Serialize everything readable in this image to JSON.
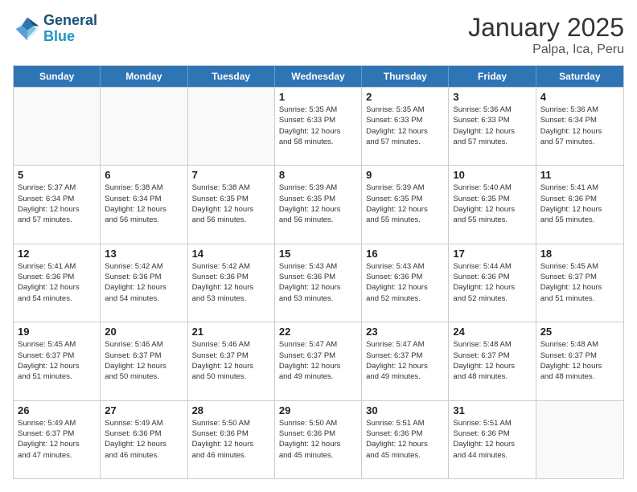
{
  "logo": {
    "line1": "General",
    "line2": "Blue"
  },
  "title": "January 2025",
  "subtitle": "Palpa, Ica, Peru",
  "weekdays": [
    "Sunday",
    "Monday",
    "Tuesday",
    "Wednesday",
    "Thursday",
    "Friday",
    "Saturday"
  ],
  "rows": [
    [
      {
        "day": "",
        "info": ""
      },
      {
        "day": "",
        "info": ""
      },
      {
        "day": "",
        "info": ""
      },
      {
        "day": "1",
        "info": "Sunrise: 5:35 AM\nSunset: 6:33 PM\nDaylight: 12 hours\nand 58 minutes."
      },
      {
        "day": "2",
        "info": "Sunrise: 5:35 AM\nSunset: 6:33 PM\nDaylight: 12 hours\nand 57 minutes."
      },
      {
        "day": "3",
        "info": "Sunrise: 5:36 AM\nSunset: 6:33 PM\nDaylight: 12 hours\nand 57 minutes."
      },
      {
        "day": "4",
        "info": "Sunrise: 5:36 AM\nSunset: 6:34 PM\nDaylight: 12 hours\nand 57 minutes."
      }
    ],
    [
      {
        "day": "5",
        "info": "Sunrise: 5:37 AM\nSunset: 6:34 PM\nDaylight: 12 hours\nand 57 minutes."
      },
      {
        "day": "6",
        "info": "Sunrise: 5:38 AM\nSunset: 6:34 PM\nDaylight: 12 hours\nand 56 minutes."
      },
      {
        "day": "7",
        "info": "Sunrise: 5:38 AM\nSunset: 6:35 PM\nDaylight: 12 hours\nand 56 minutes."
      },
      {
        "day": "8",
        "info": "Sunrise: 5:39 AM\nSunset: 6:35 PM\nDaylight: 12 hours\nand 56 minutes."
      },
      {
        "day": "9",
        "info": "Sunrise: 5:39 AM\nSunset: 6:35 PM\nDaylight: 12 hours\nand 55 minutes."
      },
      {
        "day": "10",
        "info": "Sunrise: 5:40 AM\nSunset: 6:35 PM\nDaylight: 12 hours\nand 55 minutes."
      },
      {
        "day": "11",
        "info": "Sunrise: 5:41 AM\nSunset: 6:36 PM\nDaylight: 12 hours\nand 55 minutes."
      }
    ],
    [
      {
        "day": "12",
        "info": "Sunrise: 5:41 AM\nSunset: 6:36 PM\nDaylight: 12 hours\nand 54 minutes."
      },
      {
        "day": "13",
        "info": "Sunrise: 5:42 AM\nSunset: 6:36 PM\nDaylight: 12 hours\nand 54 minutes."
      },
      {
        "day": "14",
        "info": "Sunrise: 5:42 AM\nSunset: 6:36 PM\nDaylight: 12 hours\nand 53 minutes."
      },
      {
        "day": "15",
        "info": "Sunrise: 5:43 AM\nSunset: 6:36 PM\nDaylight: 12 hours\nand 53 minutes."
      },
      {
        "day": "16",
        "info": "Sunrise: 5:43 AM\nSunset: 6:36 PM\nDaylight: 12 hours\nand 52 minutes."
      },
      {
        "day": "17",
        "info": "Sunrise: 5:44 AM\nSunset: 6:36 PM\nDaylight: 12 hours\nand 52 minutes."
      },
      {
        "day": "18",
        "info": "Sunrise: 5:45 AM\nSunset: 6:37 PM\nDaylight: 12 hours\nand 51 minutes."
      }
    ],
    [
      {
        "day": "19",
        "info": "Sunrise: 5:45 AM\nSunset: 6:37 PM\nDaylight: 12 hours\nand 51 minutes."
      },
      {
        "day": "20",
        "info": "Sunrise: 5:46 AM\nSunset: 6:37 PM\nDaylight: 12 hours\nand 50 minutes."
      },
      {
        "day": "21",
        "info": "Sunrise: 5:46 AM\nSunset: 6:37 PM\nDaylight: 12 hours\nand 50 minutes."
      },
      {
        "day": "22",
        "info": "Sunrise: 5:47 AM\nSunset: 6:37 PM\nDaylight: 12 hours\nand 49 minutes."
      },
      {
        "day": "23",
        "info": "Sunrise: 5:47 AM\nSunset: 6:37 PM\nDaylight: 12 hours\nand 49 minutes."
      },
      {
        "day": "24",
        "info": "Sunrise: 5:48 AM\nSunset: 6:37 PM\nDaylight: 12 hours\nand 48 minutes."
      },
      {
        "day": "25",
        "info": "Sunrise: 5:48 AM\nSunset: 6:37 PM\nDaylight: 12 hours\nand 48 minutes."
      }
    ],
    [
      {
        "day": "26",
        "info": "Sunrise: 5:49 AM\nSunset: 6:37 PM\nDaylight: 12 hours\nand 47 minutes."
      },
      {
        "day": "27",
        "info": "Sunrise: 5:49 AM\nSunset: 6:36 PM\nDaylight: 12 hours\nand 46 minutes."
      },
      {
        "day": "28",
        "info": "Sunrise: 5:50 AM\nSunset: 6:36 PM\nDaylight: 12 hours\nand 46 minutes."
      },
      {
        "day": "29",
        "info": "Sunrise: 5:50 AM\nSunset: 6:36 PM\nDaylight: 12 hours\nand 45 minutes."
      },
      {
        "day": "30",
        "info": "Sunrise: 5:51 AM\nSunset: 6:36 PM\nDaylight: 12 hours\nand 45 minutes."
      },
      {
        "day": "31",
        "info": "Sunrise: 5:51 AM\nSunset: 6:36 PM\nDaylight: 12 hours\nand 44 minutes."
      },
      {
        "day": "",
        "info": ""
      }
    ]
  ]
}
